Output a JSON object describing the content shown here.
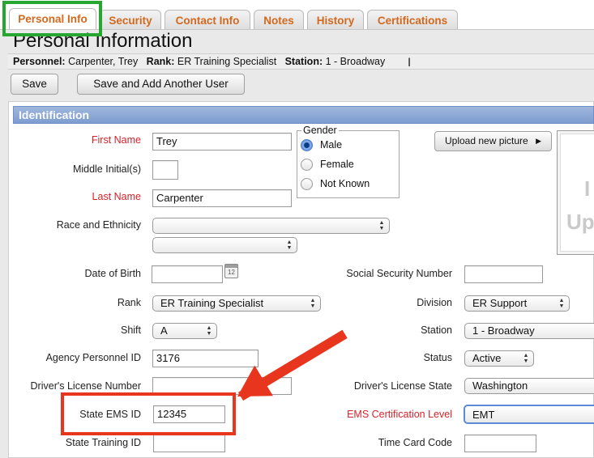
{
  "tabs": [
    "Personal Info",
    "Security",
    "Contact Info",
    "Notes",
    "History",
    "Certifications"
  ],
  "page_title": "Personal Information",
  "personnel_bar": {
    "personnel_label": "Personnel:",
    "personnel_value": "Carpenter, Trey",
    "rank_label": "Rank:",
    "rank_value": "ER Training Specialist",
    "station_label": "Station:",
    "station_value": "1 - Broadway"
  },
  "buttons": {
    "save": "Save",
    "save_add": "Save and Add Another User",
    "upload": "Upload new picture"
  },
  "section": {
    "identification": "Identification"
  },
  "fields": {
    "first_name": {
      "label": "First Name",
      "value": "Trey"
    },
    "middle_initial": {
      "label": "Middle Initial(s)",
      "value": ""
    },
    "last_name": {
      "label": "Last Name",
      "value": "Carpenter"
    },
    "race_ethnicity": {
      "label": "Race and Ethnicity",
      "value1": "",
      "value2": ""
    },
    "gender": {
      "legend": "Gender",
      "options": [
        "Male",
        "Female",
        "Not Known"
      ],
      "selected": "Male"
    },
    "dob": {
      "label": "Date of Birth",
      "value": ""
    },
    "ssn": {
      "label": "Social Security Number",
      "value": ""
    },
    "rank": {
      "label": "Rank",
      "value": "ER Training Specialist"
    },
    "division": {
      "label": "Division",
      "value": "ER Support"
    },
    "shift": {
      "label": "Shift",
      "value": "A"
    },
    "station": {
      "label": "Station",
      "value": "1 - Broadway"
    },
    "agency_id": {
      "label": "Agency Personnel ID",
      "value": "3176"
    },
    "status": {
      "label": "Status",
      "value": "Active"
    },
    "drivers_license": {
      "label": "Driver's License Number",
      "value": ""
    },
    "drivers_state": {
      "label": "Driver's License State",
      "value": "Washington"
    },
    "state_ems": {
      "label": "State EMS ID",
      "value": "12345"
    },
    "ems_level": {
      "label": "EMS Certification Level",
      "value": "EMT"
    },
    "state_training": {
      "label": "State Training ID",
      "value": ""
    },
    "time_card": {
      "label": "Time Card Code",
      "value": ""
    }
  },
  "picture_text": [
    "I",
    "Up"
  ],
  "calendar_icon_text": "12",
  "colors": {
    "tab_text": "#d2691e",
    "required_label": "#d4222b",
    "header_blue": "#7d9ccf",
    "highlight_green": "#27a630",
    "callout_red": "#e8351e"
  }
}
